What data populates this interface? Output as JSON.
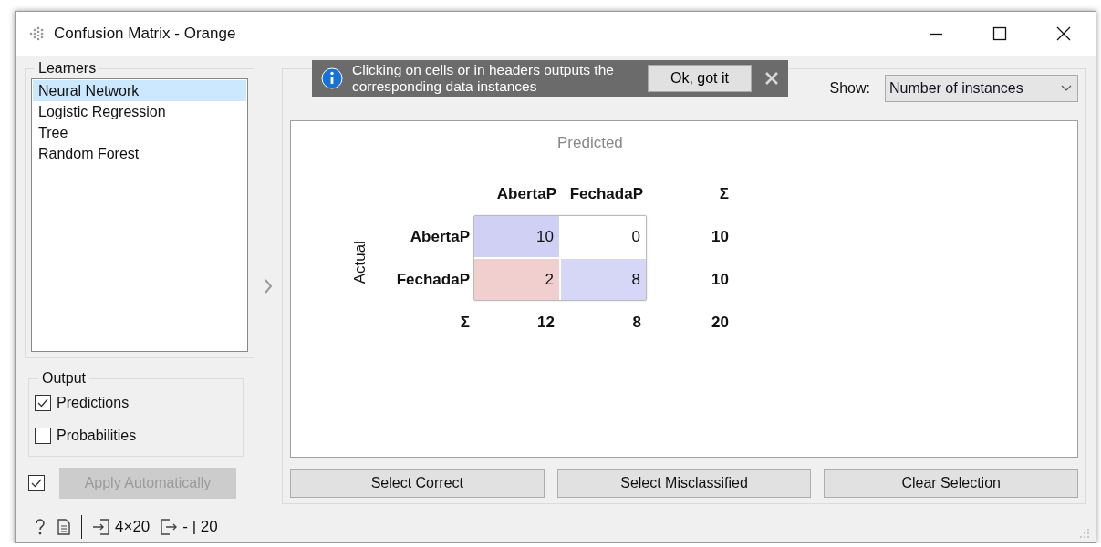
{
  "window": {
    "title": "Confusion Matrix - Orange"
  },
  "learners": {
    "title": "Learners",
    "items": [
      {
        "label": "Neural Network",
        "selected": true
      },
      {
        "label": "Logistic Regression",
        "selected": false
      },
      {
        "label": "Tree",
        "selected": false
      },
      {
        "label": "Random Forest",
        "selected": false
      }
    ]
  },
  "output": {
    "title": "Output",
    "options": [
      {
        "label": "Predictions",
        "checked": true
      },
      {
        "label": "Probabilities",
        "checked": false
      }
    ]
  },
  "apply": {
    "checked": true,
    "label": "Apply Automatically",
    "disabled": true
  },
  "notice": {
    "text": "Clicking on cells or in headers outputs the corresponding data instances",
    "button": "Ok, got it"
  },
  "show": {
    "label": "Show:",
    "value": "Number of instances"
  },
  "matrix": {
    "predicted_label": "Predicted",
    "actual_label": "Actual",
    "columns": [
      "AbertaP",
      "FechadaP"
    ],
    "column_sum_header": "Σ",
    "row_sum_label": "Σ",
    "rows": [
      {
        "label": "AbertaP",
        "cells": [
          {
            "value": "10",
            "color": "#d0d0f5"
          },
          {
            "value": "0",
            "color": "#ffffff"
          }
        ],
        "total": "10"
      },
      {
        "label": "FechadaP",
        "cells": [
          {
            "value": "2",
            "color": "#f2cfcf"
          },
          {
            "value": "8",
            "color": "#d6d6f6"
          }
        ],
        "total": "10"
      }
    ],
    "totals": [
      "12",
      "8",
      "20"
    ]
  },
  "buttons": [
    "Select Correct",
    "Select Misclassified",
    "Clear Selection"
  ],
  "status": {
    "input": "4×20",
    "output": "- | 20"
  }
}
